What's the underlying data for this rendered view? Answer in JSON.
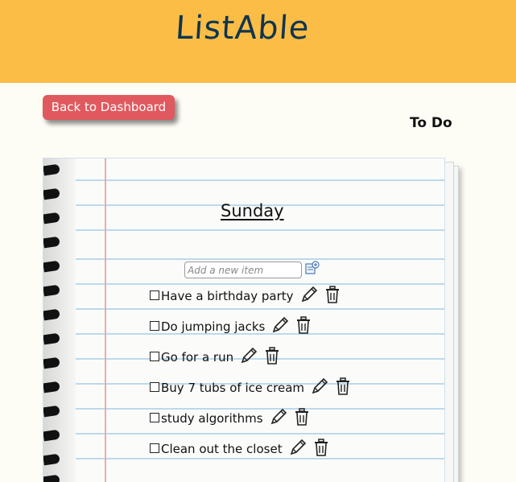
{
  "header": {
    "brand": "ListAble"
  },
  "nav": {
    "back_label": "Back to Dashboard"
  },
  "section_label": "To Do",
  "list": {
    "day": "Sunday",
    "add_placeholder": "Add a new item",
    "items": [
      {
        "text": "Have a birthday party"
      },
      {
        "text": "Do jumping jacks"
      },
      {
        "text": "Go for a run"
      },
      {
        "text": "Buy 7 tubs of ice cream"
      },
      {
        "text": "study algorithms"
      },
      {
        "text": "Clean out the closet"
      }
    ]
  },
  "colors": {
    "header_bg": "#fbbd45",
    "brand_text": "#0f3550",
    "back_button": "#e0595e",
    "page_bg": "#fdfcf5",
    "ruled_line": "#bcd9ec",
    "margin_line": "#f2a8a8"
  },
  "icons": {
    "add": "add-note-icon",
    "edit": "pencil-icon",
    "delete": "trash-icon"
  }
}
